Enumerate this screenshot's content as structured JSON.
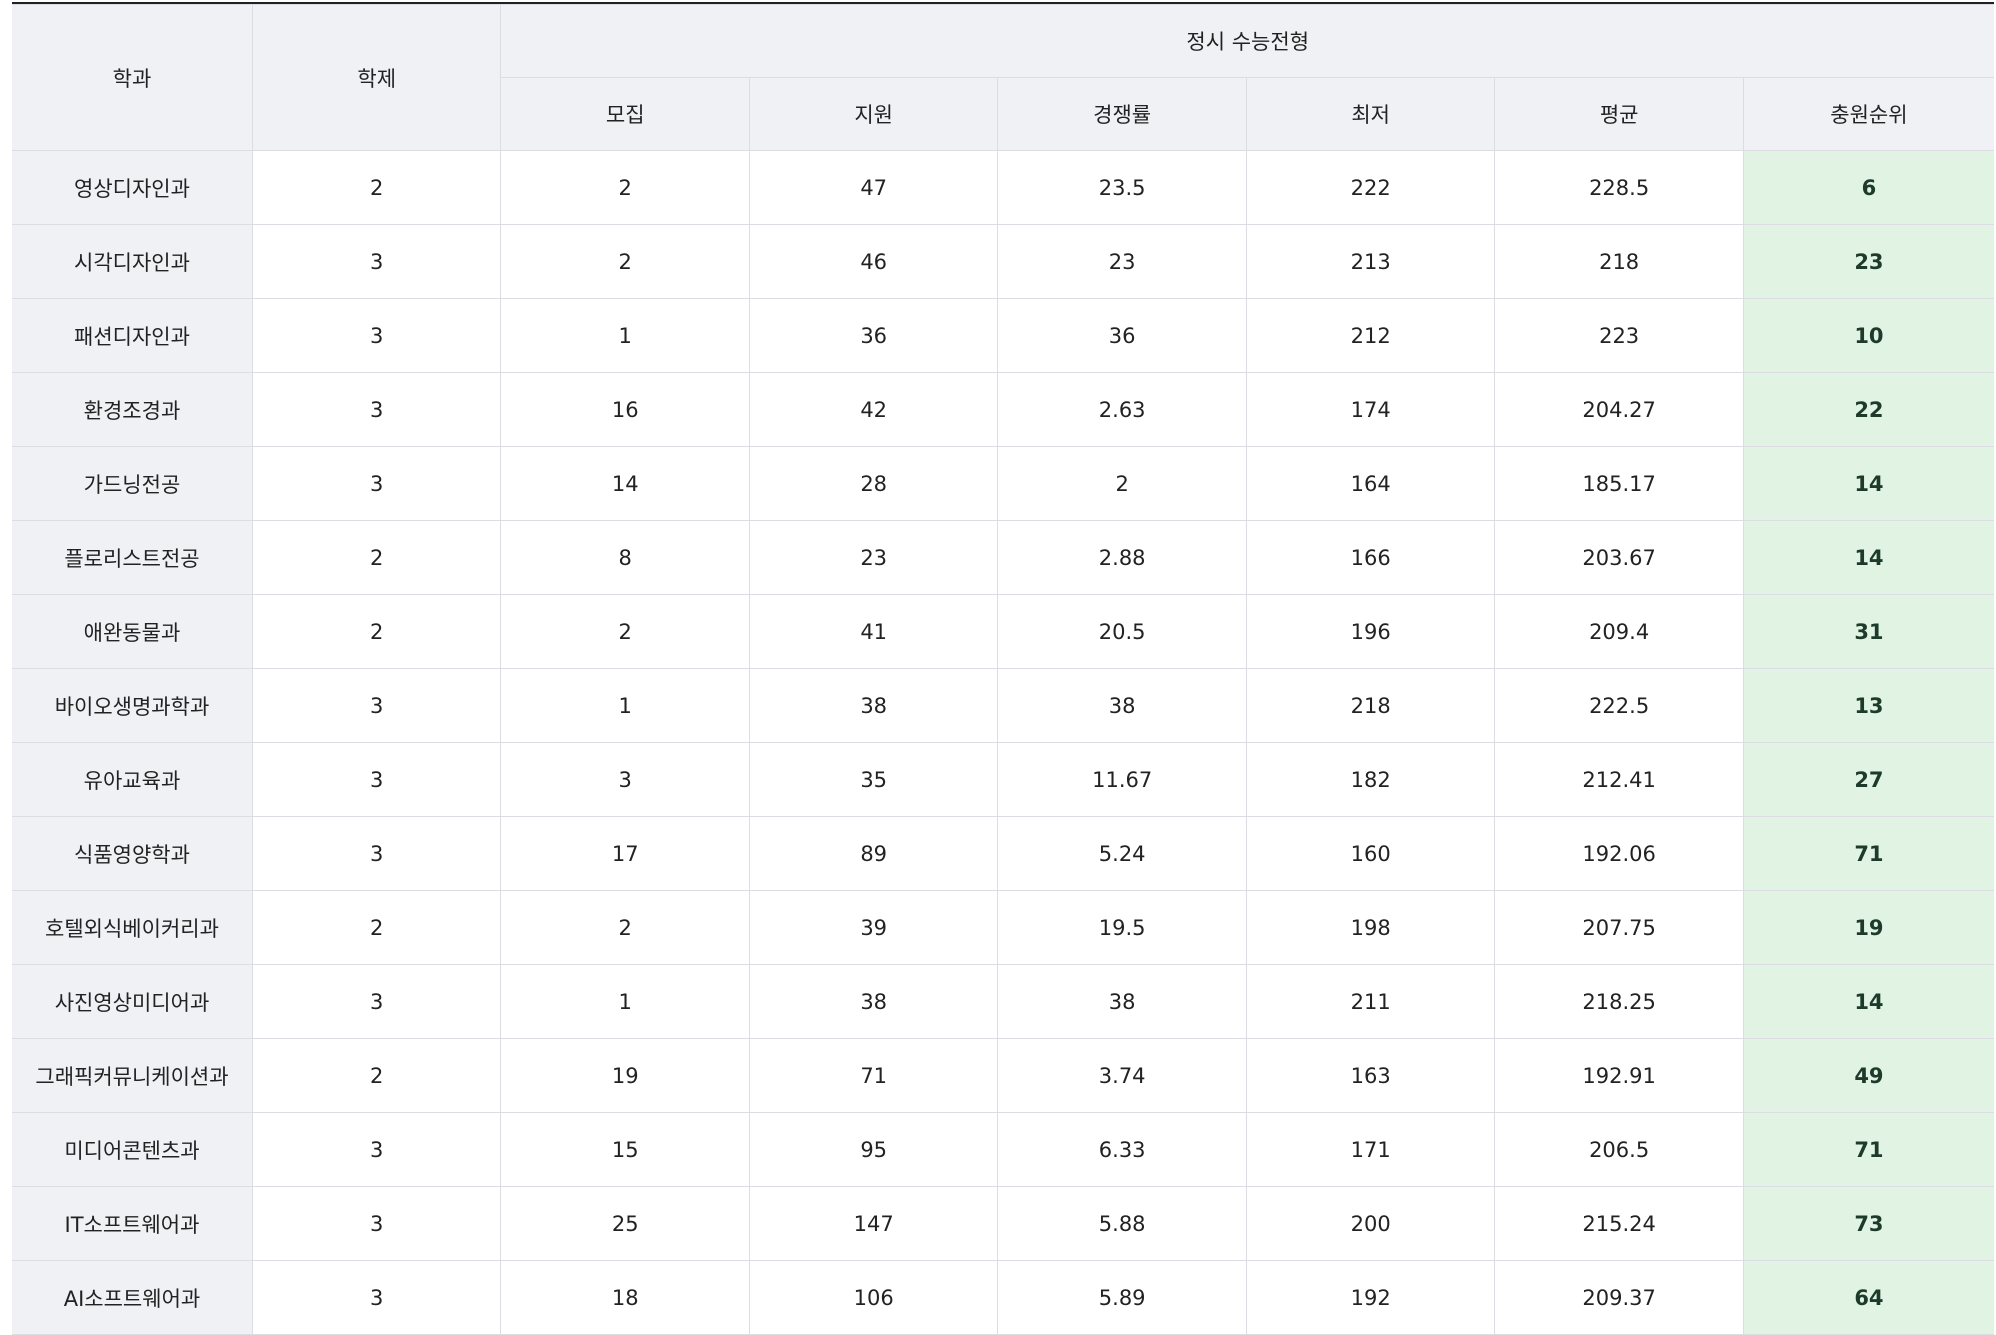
{
  "table": {
    "headers": {
      "dept": "학과",
      "term": "학제",
      "group": "정시 수능전형",
      "sub": [
        "모집",
        "지원",
        "경쟁률",
        "최저",
        "평균",
        "충원순위"
      ]
    },
    "rows": [
      {
        "dept": "영상디자인과",
        "term": "2",
        "recruit": "2",
        "apply": "47",
        "ratio": "23.5",
        "min": "222",
        "avg": "228.5",
        "rank": "6"
      },
      {
        "dept": "시각디자인과",
        "term": "3",
        "recruit": "2",
        "apply": "46",
        "ratio": "23",
        "min": "213",
        "avg": "218",
        "rank": "23"
      },
      {
        "dept": "패션디자인과",
        "term": "3",
        "recruit": "1",
        "apply": "36",
        "ratio": "36",
        "min": "212",
        "avg": "223",
        "rank": "10"
      },
      {
        "dept": "환경조경과",
        "term": "3",
        "recruit": "16",
        "apply": "42",
        "ratio": "2.63",
        "min": "174",
        "avg": "204.27",
        "rank": "22"
      },
      {
        "dept": "가드닝전공",
        "term": "3",
        "recruit": "14",
        "apply": "28",
        "ratio": "2",
        "min": "164",
        "avg": "185.17",
        "rank": "14"
      },
      {
        "dept": "플로리스트전공",
        "term": "2",
        "recruit": "8",
        "apply": "23",
        "ratio": "2.88",
        "min": "166",
        "avg": "203.67",
        "rank": "14"
      },
      {
        "dept": "애완동물과",
        "term": "2",
        "recruit": "2",
        "apply": "41",
        "ratio": "20.5",
        "min": "196",
        "avg": "209.4",
        "rank": "31"
      },
      {
        "dept": "바이오생명과학과",
        "term": "3",
        "recruit": "1",
        "apply": "38",
        "ratio": "38",
        "min": "218",
        "avg": "222.5",
        "rank": "13"
      },
      {
        "dept": "유아교육과",
        "term": "3",
        "recruit": "3",
        "apply": "35",
        "ratio": "11.67",
        "min": "182",
        "avg": "212.41",
        "rank": "27"
      },
      {
        "dept": "식품영양학과",
        "term": "3",
        "recruit": "17",
        "apply": "89",
        "ratio": "5.24",
        "min": "160",
        "avg": "192.06",
        "rank": "71"
      },
      {
        "dept": "호텔외식베이커리과",
        "term": "2",
        "recruit": "2",
        "apply": "39",
        "ratio": "19.5",
        "min": "198",
        "avg": "207.75",
        "rank": "19"
      },
      {
        "dept": "사진영상미디어과",
        "term": "3",
        "recruit": "1",
        "apply": "38",
        "ratio": "38",
        "min": "211",
        "avg": "218.25",
        "rank": "14"
      },
      {
        "dept": "그래픽커뮤니케이션과",
        "term": "2",
        "recruit": "19",
        "apply": "71",
        "ratio": "3.74",
        "min": "163",
        "avg": "192.91",
        "rank": "49"
      },
      {
        "dept": "미디어콘텐츠과",
        "term": "3",
        "recruit": "15",
        "apply": "95",
        "ratio": "6.33",
        "min": "171",
        "avg": "206.5",
        "rank": "71"
      },
      {
        "dept": "IT소프트웨어과",
        "term": "3",
        "recruit": "25",
        "apply": "147",
        "ratio": "5.88",
        "min": "200",
        "avg": "215.24",
        "rank": "73"
      },
      {
        "dept": "AI소프트웨어과",
        "term": "3",
        "recruit": "18",
        "apply": "106",
        "ratio": "5.89",
        "min": "192",
        "avg": "209.37",
        "rank": "64"
      }
    ]
  },
  "colors": {
    "header_bg": "#f0f1f5",
    "rank_bg": "#e1f4e4",
    "rank_text": "#1e3a2b",
    "border": "#dcdde3"
  }
}
